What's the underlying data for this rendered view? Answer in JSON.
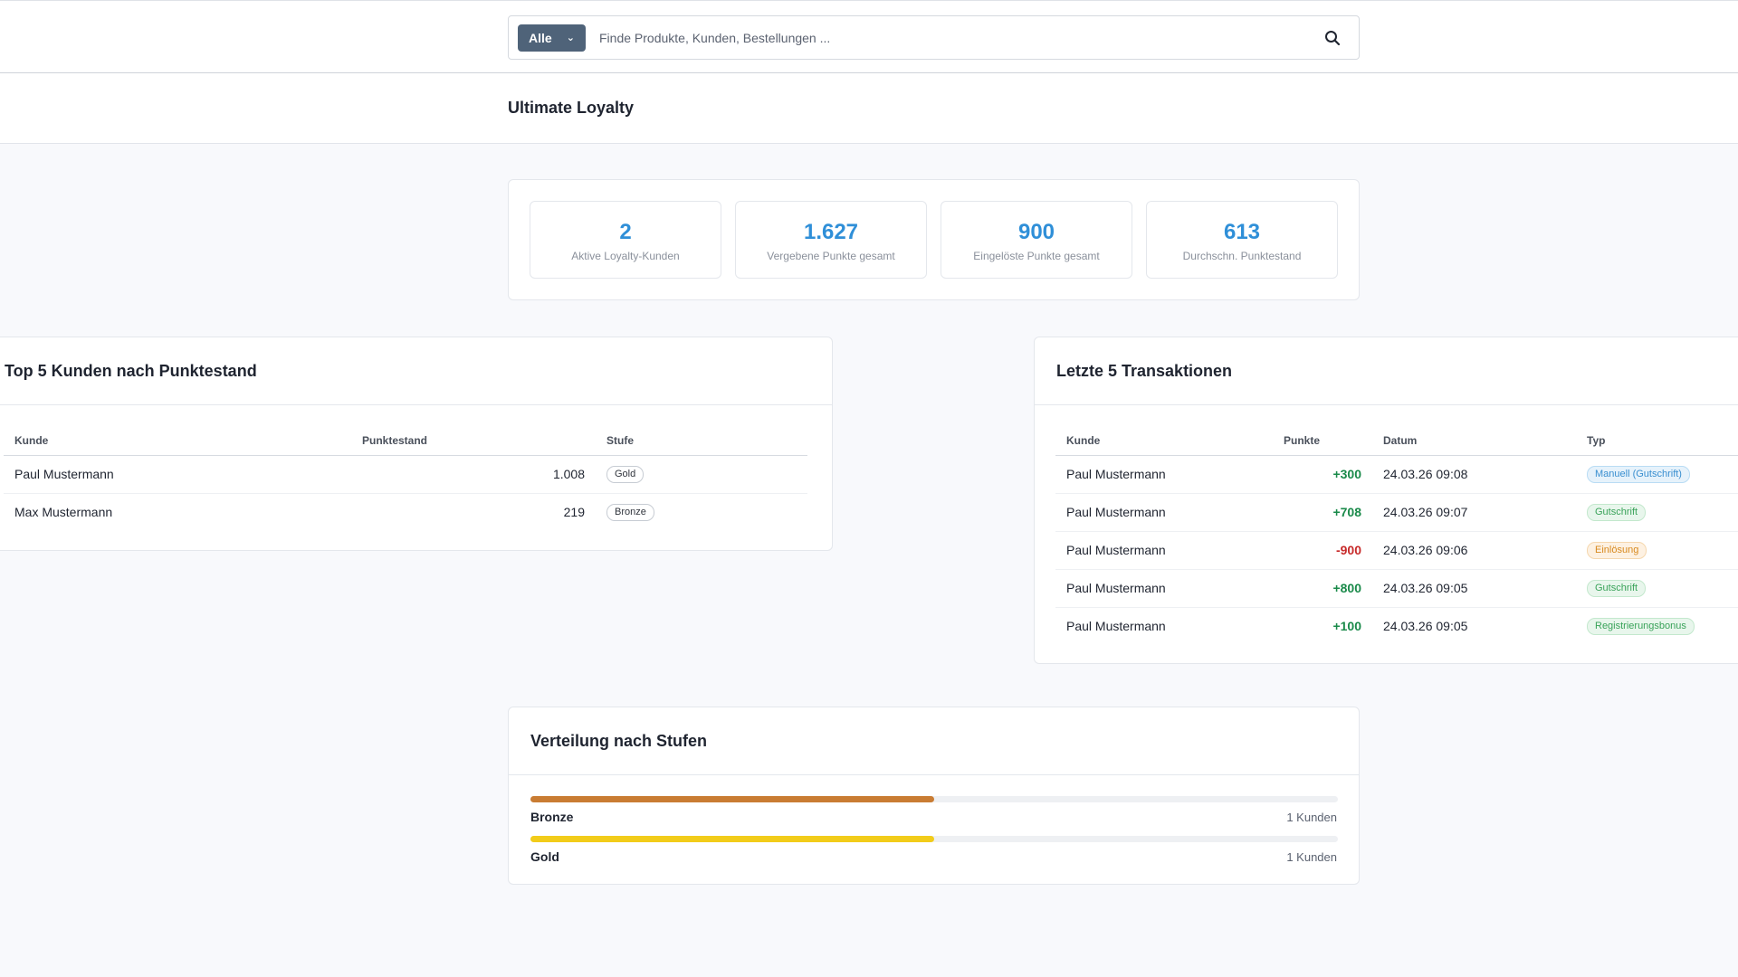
{
  "search": {
    "scope_label": "Alle",
    "placeholder": "Finde Produkte, Kunden, Bestellungen ..."
  },
  "page": {
    "title": "Ultimate Loyalty"
  },
  "stats": [
    {
      "value": "2",
      "label": "Aktive Loyalty-Kunden"
    },
    {
      "value": "1.627",
      "label": "Vergebene Punkte gesamt"
    },
    {
      "value": "900",
      "label": "Eingelöste Punkte gesamt"
    },
    {
      "value": "613",
      "label": "Durchschn. Punktestand"
    }
  ],
  "top_customers": {
    "title": "Top 5 Kunden nach Punktestand",
    "columns": [
      "Kunde",
      "Punktestand",
      "Stufe"
    ],
    "rows": [
      {
        "customer": "Paul Mustermann",
        "points": "1.008",
        "tier": "Gold"
      },
      {
        "customer": "Max Mustermann",
        "points": "219",
        "tier": "Bronze"
      }
    ]
  },
  "transactions": {
    "title": "Letzte 5 Transaktionen",
    "columns": [
      "Kunde",
      "Punkte",
      "Datum",
      "Typ"
    ],
    "rows": [
      {
        "customer": "Paul Mustermann",
        "points": "+300",
        "date": "24.03.26 09:08",
        "type": "Manuell (Gutschrift)",
        "type_color": "#3a8fd0",
        "type_bg": "#e6f2fb",
        "type_border": "#b9dcf4",
        "negative": false
      },
      {
        "customer": "Paul Mustermann",
        "points": "+708",
        "date": "24.03.26 09:07",
        "type": "Gutschrift",
        "type_color": "#3aa35a",
        "type_bg": "#e8f6ec",
        "type_border": "#c3e8cd",
        "negative": false
      },
      {
        "customer": "Paul Mustermann",
        "points": "-900",
        "date": "24.03.26 09:06",
        "type": "Einlösung",
        "type_color": "#d88a20",
        "type_bg": "#fdf1e2",
        "type_border": "#f5d7ae",
        "negative": true
      },
      {
        "customer": "Paul Mustermann",
        "points": "+800",
        "date": "24.03.26 09:05",
        "type": "Gutschrift",
        "type_color": "#3aa35a",
        "type_bg": "#e8f6ec",
        "type_border": "#c3e8cd",
        "negative": false
      },
      {
        "customer": "Paul Mustermann",
        "points": "+100",
        "date": "24.03.26 09:05",
        "type": "Registrierungsbonus",
        "type_color": "#3aa35a",
        "type_bg": "#e8f6ec",
        "type_border": "#c3e8cd",
        "negative": false
      }
    ]
  },
  "distribution": {
    "title": "Verteilung nach Stufen",
    "tiers": [
      {
        "name": "Bronze",
        "count_label": "1 Kunden",
        "share": 0.5,
        "color": "#c97c33"
      },
      {
        "name": "Gold",
        "count_label": "1 Kunden",
        "share": 0.5,
        "color": "#f2cc1a"
      }
    ]
  },
  "colors": {
    "accent": "#2f8fd8",
    "scope_button": "#4f6379",
    "positive": "#1a8a4a",
    "negative": "#c72a2a"
  }
}
